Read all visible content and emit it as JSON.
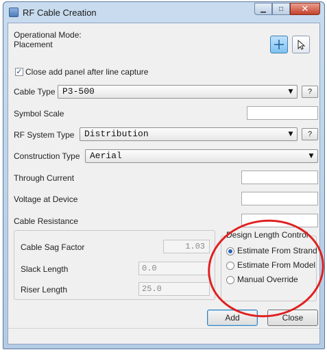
{
  "window": {
    "title": "RF Cable Creation",
    "minimize_glyph": "▁",
    "maximize_glyph": "□",
    "close_glyph": "✕"
  },
  "operational_mode": {
    "label": "Operational Mode:",
    "value": "Placement"
  },
  "tools": [
    {
      "icon": "crosshair-icon",
      "active": true
    },
    {
      "icon": "pointer-arrow-icon",
      "active": false
    }
  ],
  "close_panel_checkbox": {
    "label": "Close add panel after line capture",
    "checked": true,
    "check_glyph": "✓"
  },
  "cable_type": {
    "label": "Cable Type",
    "value": "P3-500",
    "help_label": "?"
  },
  "symbol_scale": {
    "label": "Symbol Scale",
    "value": ""
  },
  "rf_system_type": {
    "label": "RF System Type",
    "value": "Distribution",
    "help_label": "?"
  },
  "construction_type": {
    "label": "Construction Type",
    "value": "Aerial"
  },
  "through_current": {
    "label": "Through Current",
    "value": ""
  },
  "voltage_at_device": {
    "label": "Voltage at Device",
    "value": ""
  },
  "cable_resistance": {
    "label": "Cable Resistance",
    "value": ""
  },
  "sag_group": {
    "cable_sag_factor": {
      "label": "Cable Sag Factor",
      "value": "1.03"
    },
    "slack_length": {
      "label": "Slack Length",
      "value": "0.0"
    },
    "riser_length": {
      "label": "Riser Length",
      "value": "25.0"
    }
  },
  "design_length_control": {
    "title": "Design Length Control",
    "options": [
      {
        "label": "Estimate From Strand",
        "selected": true
      },
      {
        "label": "Estimate From Model",
        "selected": false
      },
      {
        "label": "Manual Override",
        "selected": false
      }
    ]
  },
  "buttons": {
    "add": "Add",
    "close": "Close"
  },
  "dropdown_arrow": "▼",
  "colors": {
    "annotation_circle": "#e02020",
    "accent": "#3c7fb1"
  }
}
